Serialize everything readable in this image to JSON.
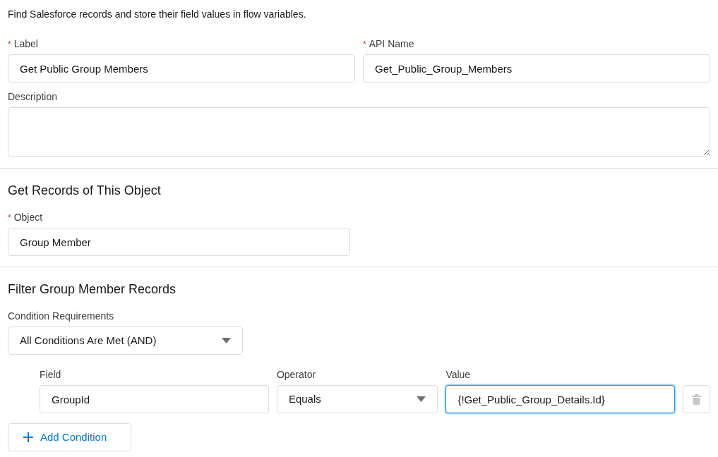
{
  "intro": "Find Salesforce records and store their field values in flow variables.",
  "top_fields": [
    {
      "label": "Label",
      "required_mark": "*",
      "value": "Get Public Group Members"
    },
    {
      "label": "API Name",
      "required_mark": "*",
      "value": "Get_Public_Group_Members"
    }
  ],
  "description": {
    "label": "Description"
  },
  "object_section": {
    "title": "Get Records of This Object",
    "field": {
      "label": "Object",
      "required_mark": "*",
      "value": "Group Member"
    }
  },
  "filter_section": {
    "title": "Filter Group Member Records",
    "requirements": {
      "label": "Condition Requirements",
      "value": "All Conditions Are Met (AND)"
    },
    "conditions": [
      {
        "field": {
          "label": "Field",
          "value": "GroupId"
        },
        "operator": {
          "label": "Operator",
          "value": "Equals"
        },
        "value": {
          "label": "Value",
          "value": "{!Get_Public_Group_Details.Id}",
          "focused": true
        },
        "delete_disabled": true
      }
    ],
    "add_button": "Add Condition"
  }
}
